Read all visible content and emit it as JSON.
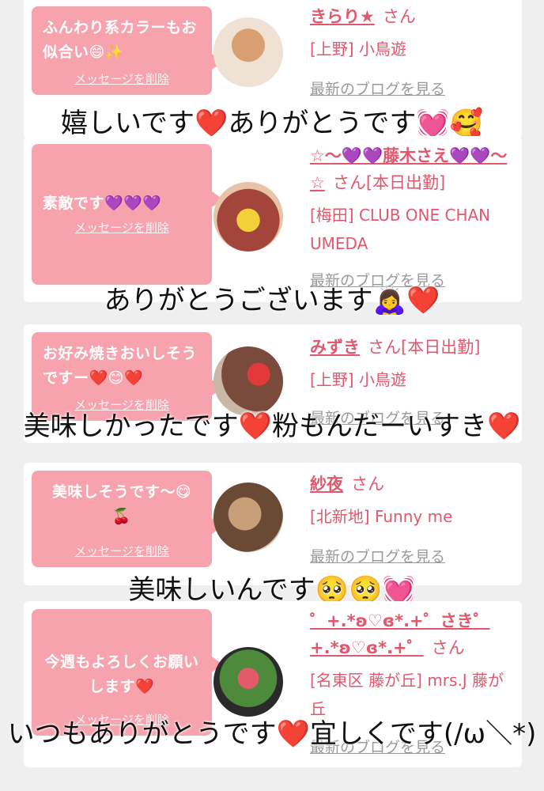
{
  "colors": {
    "accent": "#e0586e",
    "bubble": "#f7a3ae",
    "muted": "#9a9a9a"
  },
  "cards": [
    {
      "message": "ふんわり系カラーもお似合い😄✨",
      "delete_label": "メッセージを削除",
      "name": "きらり★",
      "name_suffix": "さん",
      "status": "",
      "place": "[上野] 小鳥遊",
      "blog_label": "最新のブログを見る",
      "overlay": "嬉しいです❤️ありがとうです💓🥰"
    },
    {
      "message": "素敵です💜💜💜",
      "delete_label": "メッセージを削除",
      "name": "☆〜💜💜藤木さえ💜💜〜☆",
      "name_suffix": "さん",
      "status": "[本日出勤]",
      "place": "[梅田] CLUB ONE CHAN UMEDA",
      "blog_label": "最新のブログを見る",
      "overlay": "ありがとうございます🙇‍♀️❤️"
    },
    {
      "message": "お好み焼きおいしそうですー❤️😊❤️",
      "delete_label": "メッセージを削除",
      "name": "みずき",
      "name_suffix": "さん",
      "status": "[本日出勤]",
      "place": "[上野] 小鳥遊",
      "blog_label": "最新のブログを見る",
      "overlay": "美味しかったです❤️粉もんだーいすき❤️"
    },
    {
      "message": "美味しそうです〜😋🍒",
      "delete_label": "メッセージを削除",
      "name": "紗夜",
      "name_suffix": "さん",
      "status": "",
      "place": "[北新地] Funny me",
      "blog_label": "最新のブログを見る",
      "overlay": "美味しいんです🥺🥺💓"
    },
    {
      "message": "今週もよろしくお願いします❤️",
      "delete_label": "メッセージを削除",
      "name": "゜+.*ʚ♡ɞ*.+゜さき゜+.*ʚ♡ɞ*.+゜",
      "name_suffix": "さん",
      "status": "",
      "place": "[名東区 藤が丘] mrs.J 藤が丘",
      "blog_label": "最新のブログを見る",
      "overlay": "いつもありがとうです❤️宜しくです(/ω＼*)"
    }
  ]
}
